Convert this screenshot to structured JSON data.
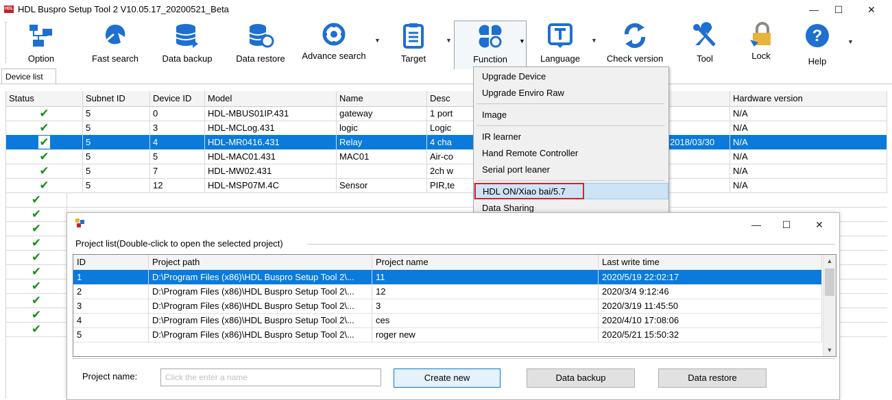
{
  "window": {
    "title": "HDL Buspro Setup Tool 2 V10.05.17_20200521_Beta",
    "logo_text": "HDL",
    "minimize": "—",
    "maximize": "☐",
    "close": "✕"
  },
  "toolbar": {
    "items": [
      {
        "label": "Option",
        "icon": "network-icon"
      },
      {
        "label": "Fast search",
        "icon": "fast-search-icon"
      },
      {
        "label": "Data backup",
        "icon": "database-icon"
      },
      {
        "label": "Data restore",
        "icon": "database-restore-icon"
      },
      {
        "label": "Advance search",
        "icon": "advance-search-icon"
      },
      {
        "label": "Target",
        "icon": "clipboard-list-icon"
      },
      {
        "label": "Function",
        "icon": "clover-function-icon"
      },
      {
        "label": "Language",
        "icon": "text-t-icon"
      },
      {
        "label": "Check version",
        "icon": "refresh-icon"
      },
      {
        "label": "Tool",
        "icon": "wrench-icon"
      },
      {
        "label": "Lock",
        "icon": "lock-icon"
      },
      {
        "label": "Help",
        "icon": "help-icon"
      }
    ],
    "dropdown_arrow": "▼"
  },
  "tabs": {
    "device_list": "Device list"
  },
  "device_grid": {
    "columns": [
      "Status",
      "Subnet ID",
      "Device ID",
      "Model",
      "Name",
      "Desc",
      "Hardware version"
    ],
    "rows": [
      {
        "status": "✔",
        "subnet": "5",
        "device": "0",
        "model": "HDL-MBUS01IP.431",
        "name": "gateway",
        "desc": "1 port",
        "date": "",
        "hw": "N/A"
      },
      {
        "status": "✔",
        "subnet": "5",
        "device": "3",
        "model": "HDL-MCLog.431",
        "name": "logic",
        "desc": "Logic",
        "date": "",
        "hw": "N/A"
      },
      {
        "status": "✔",
        "subnet": "5",
        "device": "4",
        "model": "HDL-MR0416.431",
        "name": "Relay",
        "desc": "4 cha",
        "date": "2018/03/30",
        "hw": "N/A"
      },
      {
        "status": "✔",
        "subnet": "5",
        "device": "5",
        "model": "HDL-MAC01.431",
        "name": "MAC01",
        "desc": "Air-co",
        "date": "",
        "hw": "N/A"
      },
      {
        "status": "✔",
        "subnet": "5",
        "device": "7",
        "model": "HDL-MW02.431",
        "name": "",
        "desc": "2ch w",
        "date": "",
        "hw": "N/A"
      },
      {
        "status": "✔",
        "subnet": "5",
        "device": "12",
        "model": "HDL-MSP07M.4C",
        "name": "Sensor",
        "desc": "PIR,te",
        "date": "",
        "hw": "N/A"
      }
    ],
    "extra_checks": [
      "✔",
      "✔",
      "✔",
      "✔",
      "✔",
      "✔",
      "✔",
      "✔",
      "✔",
      "✔"
    ]
  },
  "function_menu": {
    "items": [
      "Upgrade Device",
      "Upgrade Enviro Raw",
      "Image",
      "IR learner",
      "Hand Remote Controller",
      "Serial port leaner",
      "HDL ON/Xiao bai/5.7",
      "Data Sharing"
    ]
  },
  "project_dialog": {
    "group_label": "Project list(Double-click to open the selected project)",
    "columns": [
      "ID",
      "Project path",
      "Project name",
      "Last write time"
    ],
    "rows": [
      {
        "id": "1",
        "path": "D:\\Program Files (x86)\\HDL Buspro Setup Tool 2\\...",
        "name": "11",
        "time": "2020/5/19 22:02:17"
      },
      {
        "id": "2",
        "path": "D:\\Program Files (x86)\\HDL Buspro Setup Tool 2\\...",
        "name": "12",
        "time": "2020/3/4 9:12:46"
      },
      {
        "id": "3",
        "path": "D:\\Program Files (x86)\\HDL Buspro Setup Tool 2\\...",
        "name": "3",
        "time": "2020/3/19 11:45:50"
      },
      {
        "id": "4",
        "path": "D:\\Program Files (x86)\\HDL Buspro Setup Tool 2\\...",
        "name": "ces",
        "time": "2020/4/10 17:08:06"
      },
      {
        "id": "5",
        "path": "D:\\Program Files (x86)\\HDL Buspro Setup Tool 2\\...",
        "name": "roger new",
        "time": "2020/5/21 15:50:32"
      }
    ],
    "project_name_label": "Project name:",
    "project_name_placeholder": "Click the enter a name",
    "buttons": {
      "create": "Create new",
      "backup": "Data backup",
      "restore": "Data restore"
    },
    "scroll_up": "▲",
    "scroll_down": "▼"
  }
}
